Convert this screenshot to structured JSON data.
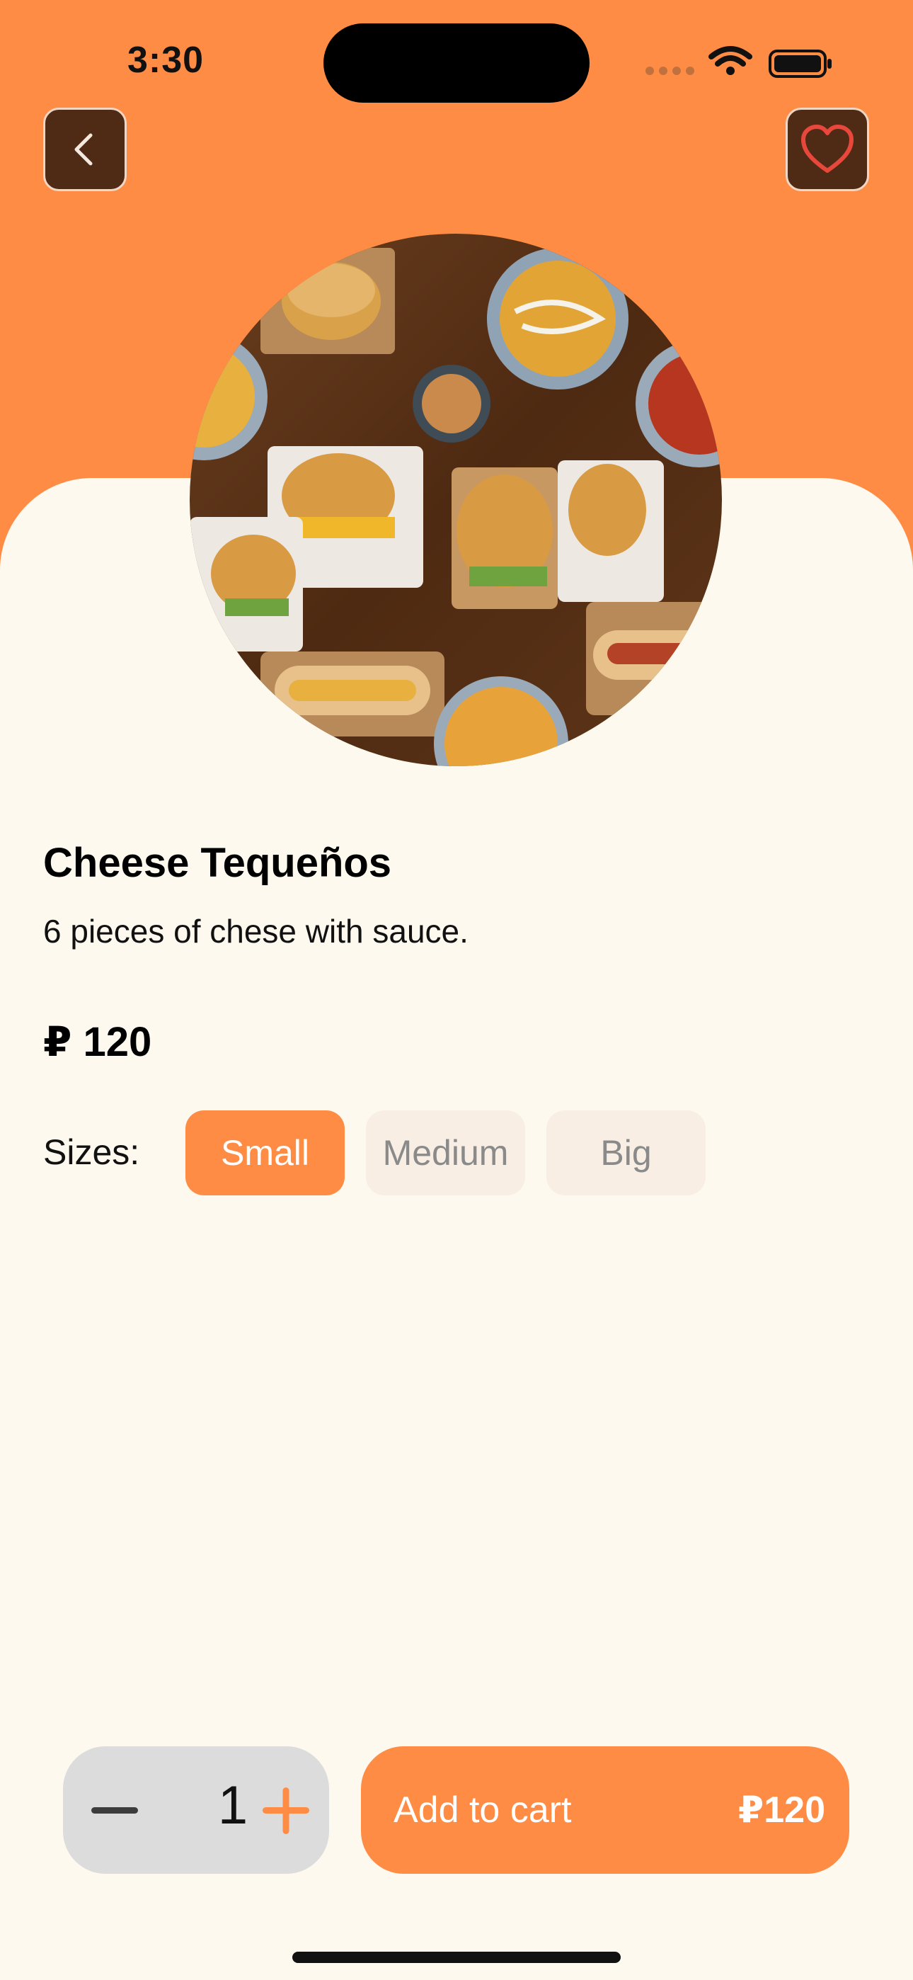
{
  "status_bar": {
    "time": "3:30"
  },
  "header": {
    "back_icon": "chevron-left-icon",
    "favorite_icon": "heart-icon"
  },
  "product": {
    "image_alt": "food-photo",
    "name": "Cheese Tequeños",
    "description": "6 pieces of chese with sauce.",
    "price": "₽ 120"
  },
  "sizes": {
    "label": "Sizes:",
    "options": [
      {
        "label": "Small",
        "selected": true
      },
      {
        "label": "Medium",
        "selected": false
      },
      {
        "label": "Big",
        "selected": false
      }
    ]
  },
  "cart": {
    "quantity": "1",
    "add_label": "Add to cart",
    "total": "₽120"
  },
  "colors": {
    "accent": "#FF8C45",
    "background": "#FEF9EE",
    "dark_button": "#4F2A14",
    "heart": "#E8473C"
  }
}
